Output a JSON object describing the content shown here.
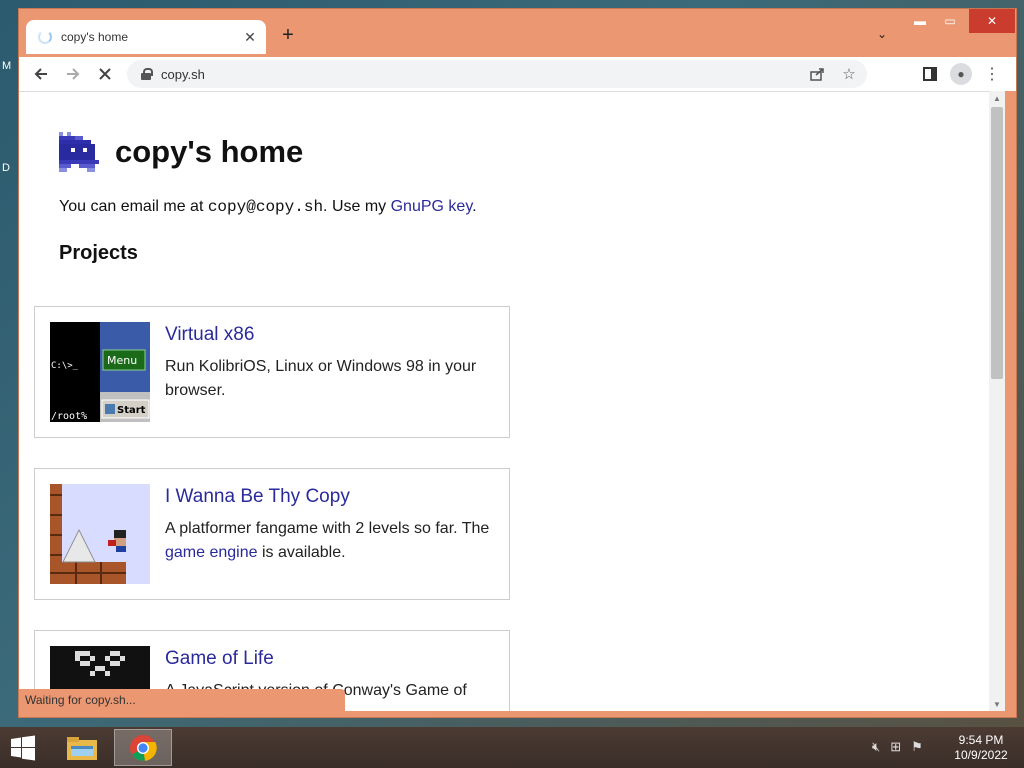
{
  "browser": {
    "tab_title": "copy's home",
    "tab_close_icon": "close-icon",
    "new_tab_icon": "plus-icon",
    "tab_search_icon": "chevron-down-icon",
    "url": "copy.sh",
    "status_text": "Waiting for copy.sh..."
  },
  "page": {
    "title": "copy's home",
    "intro_prefix": "You can email me at ",
    "email": "copy@copy.sh",
    "intro_mid": ". Use my ",
    "gpg_link": "GnuPG key",
    "intro_suffix": ".",
    "projects_heading": "Projects",
    "projects": [
      {
        "title": "Virtual x86",
        "desc": "Run KolibriOS, Linux or Windows 98 in your browser.",
        "thumb_prompt": "C:\\>_",
        "thumb_root": "/root%",
        "thumb_menu": "Menu",
        "thumb_start": "Start"
      },
      {
        "title": "I Wanna Be Thy Copy",
        "desc_prefix": "A platformer fangame with 2 levels so far. The ",
        "desc_link": "game engine",
        "desc_suffix": " is available."
      },
      {
        "title": "Game of Life",
        "desc": "A JavaScript version of Conway's Game of"
      }
    ]
  },
  "taskbar": {
    "time": "9:54 PM",
    "date": "10/9/2022"
  },
  "colors": {
    "window_frame": "#eb9771",
    "link": "#2a2a9a",
    "close_button": "#c93c2e"
  }
}
